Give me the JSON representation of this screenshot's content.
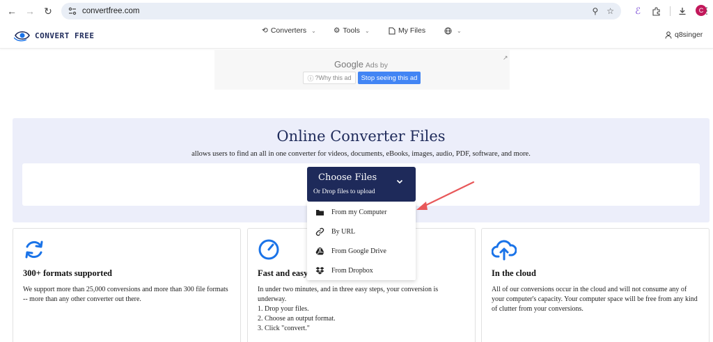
{
  "browser": {
    "url": "convertfree.com",
    "profile_initial": "C"
  },
  "site": {
    "logo_text": "CONVERT FREE",
    "nav": {
      "converters": "Converters",
      "tools": "Tools",
      "my_files": "My Files"
    },
    "user": "q8singer"
  },
  "ad": {
    "google": "Google",
    "ads_by": "Ads by",
    "why": "?Why this ad",
    "stop": "Stop seeing this ad"
  },
  "hero": {
    "title": "Online Converter Files",
    "subtitle": "allows users to find an all in one converter for videos, documents, eBooks, images, audio, PDF, software, and more.",
    "choose_title": "Choose Files",
    "choose_sub": "Or Drop files to upload"
  },
  "upload_menu": {
    "items": [
      {
        "label": "From my Computer",
        "icon": "folder-icon"
      },
      {
        "label": "By URL",
        "icon": "link-icon"
      },
      {
        "label": "From Google Drive",
        "icon": "google-drive-icon"
      },
      {
        "label": "From Dropbox",
        "icon": "dropbox-icon"
      }
    ]
  },
  "cards": [
    {
      "title": "300+ formats supported",
      "lines": [
        "We support more than 25,000 conversions and more than 300 file formats -- more than any other converter out there."
      ],
      "icon": "refresh-icon"
    },
    {
      "title": "Fast and easy",
      "lines": [
        "In under two minutes, and in three easy steps, your conversion is underway.",
        "1. Drop your files.",
        "2. Choose an output format.",
        "3. Click \"convert.\""
      ],
      "icon": "gauge-icon"
    },
    {
      "title": "In the cloud",
      "lines": [
        "All of our conversions occur in the cloud and will not consume any of your computer's capacity. Your computer space will be free from any kind of clutter from your conversions."
      ],
      "icon": "cloud-upload-icon"
    }
  ],
  "colors": {
    "brand_navy": "#1e2a5a",
    "accent_blue": "#1a73e8",
    "hero_bg": "#eceefa",
    "annotation_red": "#e8585a"
  }
}
